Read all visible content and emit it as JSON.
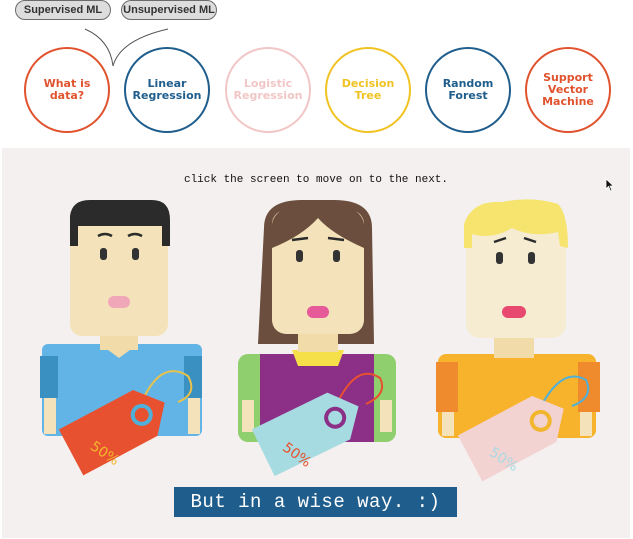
{
  "nav": {
    "pills": [
      {
        "label": "Supervised ML"
      },
      {
        "label": "Unsupervised ML"
      }
    ],
    "circles": [
      {
        "label": "What is\ndata?",
        "color": "#e0532e"
      },
      {
        "label": "Linear\nRegression",
        "color": "#1e5d8c"
      },
      {
        "label": "Logistic\nRegression",
        "color": "#f2c6c6"
      },
      {
        "label": "Decision\nTree",
        "color": "#f0c323"
      },
      {
        "label": "Random\nForest",
        "color": "#1e5d8c"
      },
      {
        "label": "Support\nVector\nMachine",
        "color": "#e0532e"
      }
    ]
  },
  "stage": {
    "hint": "click the screen to move on to the next.",
    "banner": "But in a wise way. :)",
    "tags": [
      {
        "text": "50%"
      },
      {
        "text": "50%"
      },
      {
        "text": "50%"
      }
    ]
  }
}
